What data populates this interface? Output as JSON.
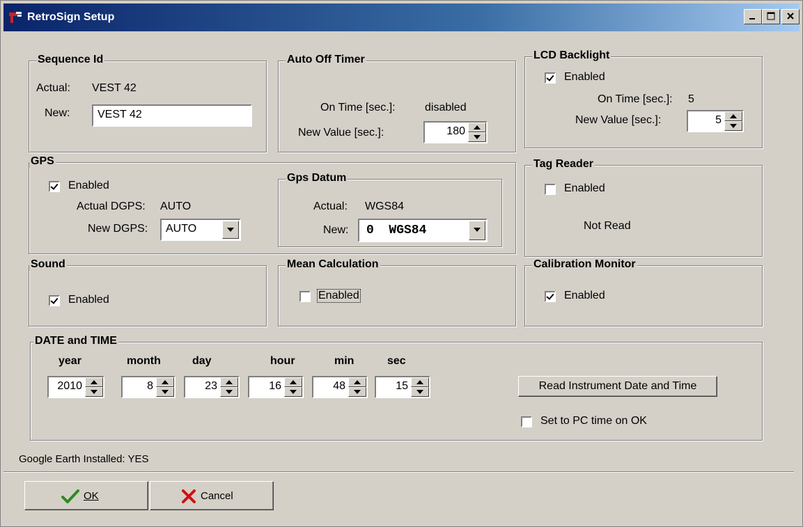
{
  "window": {
    "title": "RetroSign Setup"
  },
  "sequence": {
    "title": "Sequence Id",
    "actual_label": "Actual:",
    "actual_value": "VEST 42",
    "new_label": "New:",
    "new_value": "VEST 42"
  },
  "auto_off": {
    "title": "Auto Off Timer",
    "on_time_label": "On Time [sec.]:",
    "on_time_value": "disabled",
    "new_value_label": "New Value [sec.]:",
    "new_value": "180"
  },
  "lcd": {
    "title": "LCD Backlight",
    "enabled_label": "Enabled",
    "enabled": true,
    "on_time_label": "On Time [sec.]:",
    "on_time_value": "5",
    "new_value_label": "New Value [sec.]:",
    "new_value": "5"
  },
  "gps": {
    "title": "GPS",
    "enabled_label": "Enabled",
    "enabled": true,
    "actual_label": "Actual DGPS:",
    "actual_value": "AUTO",
    "new_label": "New DGPS:",
    "new_value": "AUTO"
  },
  "datum": {
    "title": "Gps Datum",
    "actual_label": "Actual:",
    "actual_value": "WGS84",
    "new_label": "New:",
    "new_value": "0  WGS84"
  },
  "tag": {
    "title": "Tag Reader",
    "enabled_label": "Enabled",
    "enabled": false,
    "status": "Not Read"
  },
  "sound": {
    "title": "Sound",
    "enabled_label": "Enabled",
    "enabled": true
  },
  "mean": {
    "title": "Mean Calculation",
    "enabled_label": "Enabled",
    "enabled": false
  },
  "calib": {
    "title": "Calibration Monitor",
    "enabled_label": "Enabled",
    "enabled": true
  },
  "datetime": {
    "title": "DATE and TIME",
    "headers": {
      "year": "year",
      "month": "month",
      "day": "day",
      "hour": "hour",
      "min": "min",
      "sec": "sec"
    },
    "values": {
      "year": "2010",
      "month": "8",
      "day": "23",
      "hour": "16",
      "min": "48",
      "sec": "15"
    },
    "read_button": "Read Instrument Date and Time",
    "set_pc_label": "Set to PC time on OK",
    "set_pc": false
  },
  "status": {
    "google_earth": "Google Earth Installed: YES"
  },
  "buttons": {
    "ok": "OK",
    "cancel": "Cancel"
  }
}
